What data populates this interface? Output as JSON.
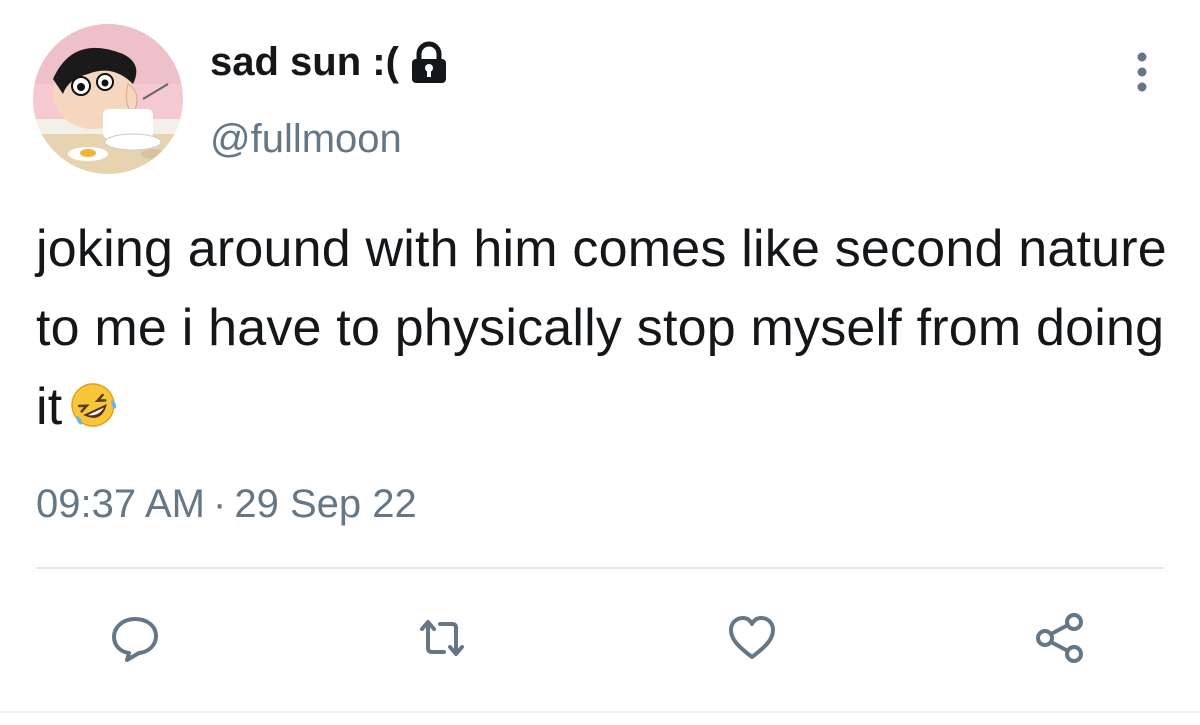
{
  "user": {
    "display_name": "sad sun :(",
    "handle": "@fullmoon",
    "protected": true,
    "avatar": "avatar"
  },
  "tweet": {
    "text": "joking around with him comes like second nature to me i have to physically stop myself from doing it",
    "emoji": "rolling-on-floor-laughing-emoji"
  },
  "meta": {
    "time": "09:37 AM",
    "separator": "·",
    "date": "29 Sep 22"
  },
  "actions": [
    {
      "name": "reply",
      "icon": "reply-icon"
    },
    {
      "name": "retweet",
      "icon": "retweet-icon"
    },
    {
      "name": "like",
      "icon": "heart-icon"
    },
    {
      "name": "share",
      "icon": "share-icon"
    }
  ],
  "colors": {
    "text_primary": "#14171a",
    "text_secondary": "#657786",
    "divider": "#e1e8ed",
    "icon": "#657786"
  }
}
